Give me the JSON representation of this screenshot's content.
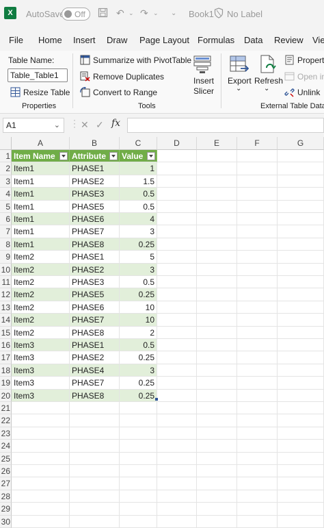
{
  "titlebar": {
    "app_icon": "X",
    "autosave_label": "AutoSave",
    "toggle_label": "Off",
    "book_name": "Book1",
    "label_status": "No Label"
  },
  "menu": {
    "tabs": [
      "File",
      "Home",
      "Insert",
      "Draw",
      "Page Layout",
      "Formulas",
      "Data",
      "Review",
      "Vie"
    ]
  },
  "ribbon": {
    "properties": {
      "table_name_label": "Table Name:",
      "table_name_value": "Table_Table1",
      "resize_label": "Resize Table",
      "group_label": "Properties"
    },
    "tools": {
      "pivot_label": "Summarize with PivotTable",
      "dedupe_label": "Remove Duplicates",
      "range_label": "Convert to Range",
      "slicer_line1": "Insert",
      "slicer_line2": "Slicer",
      "group_label": "Tools"
    },
    "external": {
      "export_label": "Export",
      "refresh_label": "Refresh",
      "properties_label": "Properti",
      "open_label": "Open in",
      "unlink_label": "Unlink",
      "group_label": "External Table Data"
    }
  },
  "formula_bar": {
    "name_box": "A1",
    "fx_label": "fx",
    "cancel_glyph": "✕",
    "enter_glyph": "✓",
    "formula": ""
  },
  "sheet": {
    "columns": [
      "A",
      "B",
      "C",
      "D",
      "E",
      "F",
      "G"
    ],
    "headers": [
      "Item Name",
      "Attribute",
      "Value"
    ],
    "rows": [
      [
        "Item1",
        "PHASE1",
        "1"
      ],
      [
        "Item1",
        "PHASE2",
        "1.5"
      ],
      [
        "Item1",
        "PHASE3",
        "0.5"
      ],
      [
        "Item1",
        "PHASE5",
        "0.5"
      ],
      [
        "Item1",
        "PHASE6",
        "4"
      ],
      [
        "Item1",
        "PHASE7",
        "3"
      ],
      [
        "Item1",
        "PHASE8",
        "0.25"
      ],
      [
        "Item2",
        "PHASE1",
        "5"
      ],
      [
        "Item2",
        "PHASE2",
        "3"
      ],
      [
        "Item2",
        "PHASE3",
        "0.5"
      ],
      [
        "Item2",
        "PHASE5",
        "0.25"
      ],
      [
        "Item2",
        "PHASE6",
        "10"
      ],
      [
        "Item2",
        "PHASE7",
        "10"
      ],
      [
        "Item2",
        "PHASE8",
        "2"
      ],
      [
        "Item3",
        "PHASE1",
        "0.5"
      ],
      [
        "Item3",
        "PHASE2",
        "0.25"
      ],
      [
        "Item3",
        "PHASE4",
        "3"
      ],
      [
        "Item3",
        "PHASE7",
        "0.25"
      ],
      [
        "Item3",
        "PHASE8",
        "0.25"
      ]
    ],
    "row_numbers": [
      "1",
      "2",
      "3",
      "4",
      "5",
      "6",
      "7",
      "8",
      "9",
      "10",
      "11",
      "12",
      "13",
      "14",
      "15",
      "16",
      "17",
      "18",
      "19",
      "20",
      "21",
      "22",
      "23",
      "24",
      "25",
      "26",
      "27",
      "28",
      "29",
      "30"
    ],
    "table_header_color": "#70ad47",
    "band_color": "#e2efda"
  }
}
